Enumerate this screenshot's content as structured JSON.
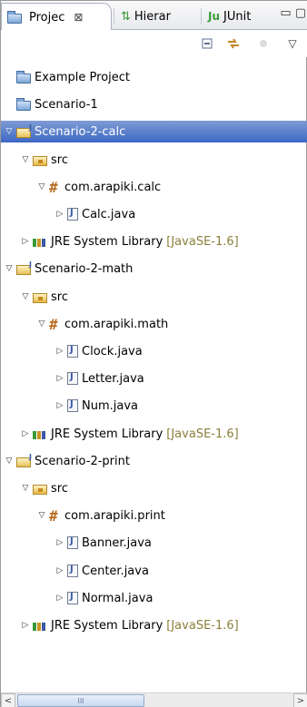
{
  "tabs": [
    {
      "label": "Projec",
      "close": "⊠"
    },
    {
      "label": "Hierar"
    },
    {
      "label": "JUnit"
    }
  ],
  "window_buttons": {
    "minimize": "▭",
    "maximize": "▢"
  },
  "toolbar": {
    "collapse_all": "collapse-all-icon",
    "link_editor": "link-with-editor-icon",
    "disabled": "view-menu-disabled-icon",
    "menu": "▽"
  },
  "tree": [
    {
      "label": "Example Project",
      "icon": "folder-blue",
      "indent": 0,
      "twisty": ""
    },
    {
      "label": "Scenario-1",
      "icon": "folder-blue",
      "indent": 0,
      "twisty": ""
    },
    {
      "label": "Scenario-2-calc",
      "icon": "proj-j",
      "indent": 0,
      "twisty": "▽",
      "selected": true
    },
    {
      "label": "src",
      "icon": "src-folder",
      "indent": 1,
      "twisty": "▽"
    },
    {
      "label": "com.arapiki.calc",
      "icon": "pkg",
      "indent": 2,
      "twisty": "▽"
    },
    {
      "label": "Calc.java",
      "icon": "jfile",
      "indent": 3,
      "twisty": "▷"
    },
    {
      "label": "JRE System Library",
      "icon": "lib",
      "indent": 1,
      "twisty": "▷",
      "deco": "[JavaSE-1.6]"
    },
    {
      "label": "Scenario-2-math",
      "icon": "proj-j",
      "indent": 0,
      "twisty": "▽"
    },
    {
      "label": "src",
      "icon": "src-folder",
      "indent": 1,
      "twisty": "▽"
    },
    {
      "label": "com.arapiki.math",
      "icon": "pkg",
      "indent": 2,
      "twisty": "▽"
    },
    {
      "label": "Clock.java",
      "icon": "jfile",
      "indent": 3,
      "twisty": "▷"
    },
    {
      "label": "Letter.java",
      "icon": "jfile",
      "indent": 3,
      "twisty": "▷"
    },
    {
      "label": "Num.java",
      "icon": "jfile",
      "indent": 3,
      "twisty": "▷"
    },
    {
      "label": "JRE System Library",
      "icon": "lib",
      "indent": 1,
      "twisty": "▷",
      "deco": "[JavaSE-1.6]"
    },
    {
      "label": "Scenario-2-print",
      "icon": "proj-j",
      "indent": 0,
      "twisty": "▽"
    },
    {
      "label": "src",
      "icon": "src-folder",
      "indent": 1,
      "twisty": "▽"
    },
    {
      "label": "com.arapiki.print",
      "icon": "pkg",
      "indent": 2,
      "twisty": "▽"
    },
    {
      "label": "Banner.java",
      "icon": "jfile",
      "indent": 3,
      "twisty": "▷"
    },
    {
      "label": "Center.java",
      "icon": "jfile",
      "indent": 3,
      "twisty": "▷"
    },
    {
      "label": "Normal.java",
      "icon": "jfile",
      "indent": 3,
      "twisty": "▷"
    },
    {
      "label": "JRE System Library",
      "icon": "lib",
      "indent": 1,
      "twisty": "▷",
      "deco": "[JavaSE-1.6]"
    }
  ],
  "scrollbar": {
    "left": "<",
    "right": ">",
    "grip": "III"
  }
}
